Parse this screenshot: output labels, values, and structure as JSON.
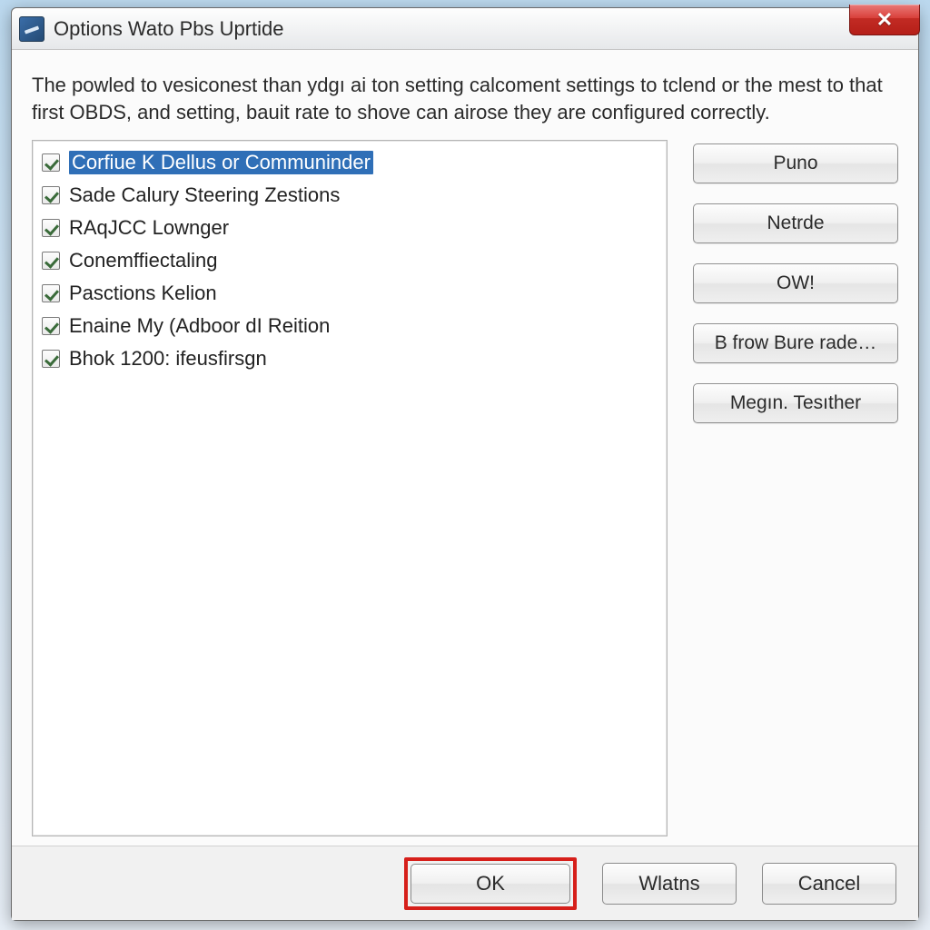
{
  "window": {
    "title": "Options Wato Pbs Uprtide",
    "close_glyph": "✕"
  },
  "description": "The powled to vesiconest than ydgı ai ton setting calcoment settings to tclend or the mest to that first OBDS, and setting, bauit rate to shove can airose they are configured correctly.",
  "list": {
    "items": [
      {
        "label": "Corfiue K Dellus or Communinder",
        "checked": true,
        "selected": true
      },
      {
        "label": "Sade Calury Steering Zestions",
        "checked": true,
        "selected": false
      },
      {
        "label": "RAqJCC Lownger",
        "checked": true,
        "selected": false
      },
      {
        "label": "Conemffiectaling",
        "checked": true,
        "selected": false
      },
      {
        "label": "Pasctions Kelion",
        "checked": true,
        "selected": false
      },
      {
        "label": "Enaine My (Adboor dI Reition",
        "checked": true,
        "selected": false
      },
      {
        "label": "Bhok 1200: ifeusfirsgn",
        "checked": true,
        "selected": false
      }
    ]
  },
  "side_buttons": {
    "b0": "Puno",
    "b1": "Netrde",
    "b2": "OW!",
    "b3": "B frow Bure rade…",
    "b4": "Megın. Tesıther"
  },
  "footer": {
    "ok": "OK",
    "wlatns": "Wlatns",
    "cancel": "Cancel"
  }
}
